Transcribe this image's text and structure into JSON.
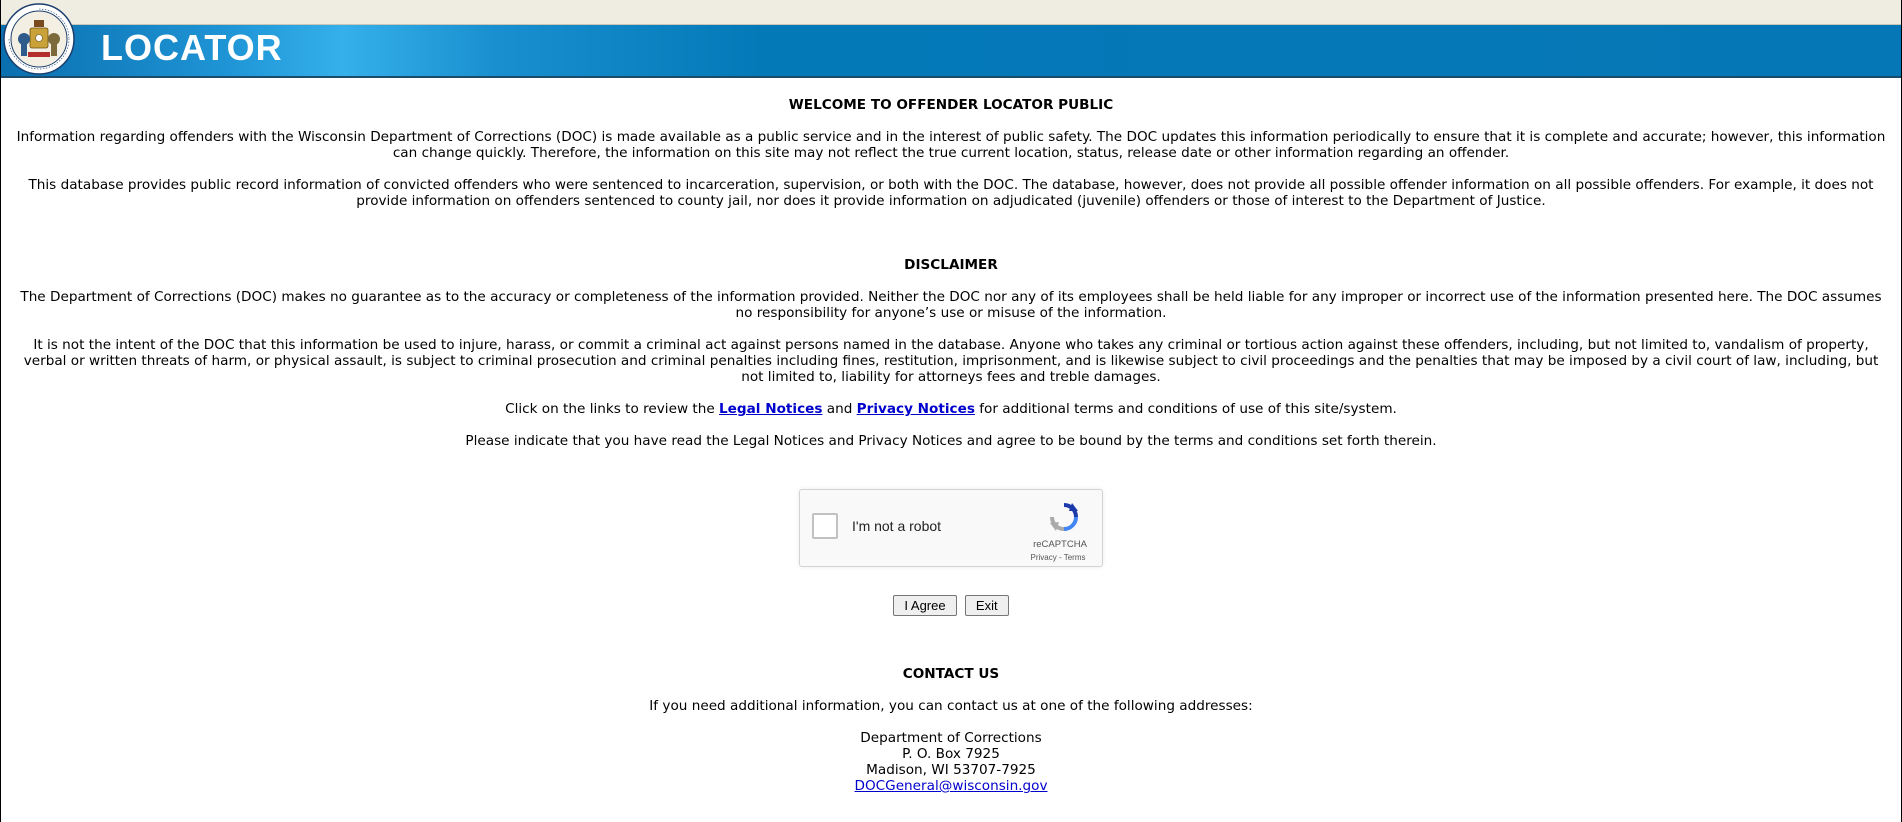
{
  "header": {
    "title": "LOCATOR",
    "seal_icon": "state-of-wisconsin-seal-icon",
    "colors": {
      "banner": "#0677b6",
      "top_strip": "#efede2"
    }
  },
  "welcome": {
    "heading": "WELCOME TO OFFENDER LOCATOR PUBLIC",
    "paragraph1": "Information regarding offenders with the Wisconsin Department of Corrections (DOC) is made available as a public service and in the interest of public safety. The DOC updates this information periodically to ensure that it is complete and accurate; however, this information can change quickly. Therefore, the information on this site may not reflect the true current location, status, release date or other information regarding an offender.",
    "paragraph2": "This database provides public record information of convicted offenders who were sentenced to incarceration, supervision, or both with the DOC. The database, however, does not provide all possible offender information on all possible offenders. For example, it does not provide information on offenders sentenced to county jail, nor does it provide information on adjudicated (juvenile) offenders or those of interest to the Department of Justice."
  },
  "disclaimer": {
    "heading": "DISCLAIMER",
    "paragraph1": "The Department of Corrections (DOC) makes no guarantee as to the accuracy or completeness of the information provided. Neither the DOC nor any of its employees shall be held liable for any improper or incorrect use of the information presented here. The DOC assumes no responsibility for anyone’s use or misuse of the information.",
    "paragraph2": "It is not the intent of the DOC that this information be used to injure, harass, or commit a criminal act against persons named in the database. Anyone who takes any criminal or tortious action against these offenders, including, but not limited to, vandalism of property, verbal or written threats of harm, or physical assault, is subject to criminal prosecution and criminal penalties including fines, restitution, imprisonment, and is likewise subject to civil proceedings and the penalties that may be imposed by a civil court of law, including, but not limited to, liability for attorneys fees and treble damages.",
    "links_prefix": "Click on the links to review the ",
    "legal_link": "Legal Notices",
    "links_and": " and ",
    "privacy_link": "Privacy Notices",
    "links_suffix": " for additional terms and conditions of use of this site/system.",
    "agree_prompt": "Please indicate that you have read the Legal Notices and Privacy Notices and agree to be bound by the terms and conditions set forth therein."
  },
  "captcha": {
    "label": "I'm not a robot",
    "brand": "reCAPTCHA",
    "privacy": "Privacy",
    "separator": " - ",
    "terms": "Terms"
  },
  "buttons": {
    "agree": "I Agree",
    "exit": "Exit"
  },
  "contact": {
    "heading": "CONTACT US",
    "intro": "If you need additional information, you can contact us at one of the following addresses:",
    "line1": "Department of Corrections",
    "line2": "P. O. Box 7925",
    "line3": "Madison, WI 53707-7925",
    "email": "DOCGeneral@wisconsin.gov"
  }
}
